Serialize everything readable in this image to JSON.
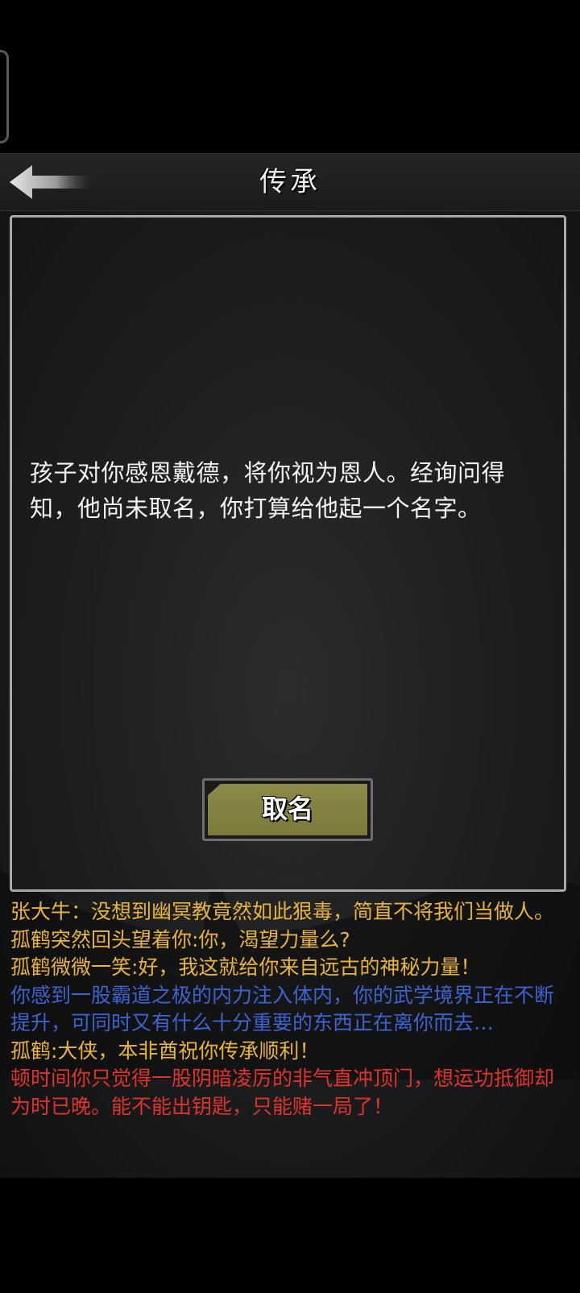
{
  "header": {
    "title": "传承",
    "back_icon": "back-arrow-icon"
  },
  "dialog": {
    "text": "孩子对你感恩戴德，将你视为恩人。经询问得知，他尚未取名，你打算给他起一个名字。",
    "button_label": "取名"
  },
  "log": {
    "lines": [
      {
        "text": "张大牛：没想到幽冥教竟然如此狠毒，简直不将我们当做人。",
        "color": "#e8b43a"
      },
      {
        "text": "孤鹤突然回头望着你:你，渴望力量么?",
        "color": "#e8b43a"
      },
      {
        "text": "孤鹤微微一笑:好，我这就给你来自远古的神秘力量！",
        "color": "#e8b43a"
      },
      {
        "text": "你感到一股霸道之极的内力注入体内，你的武学境界正在不断提升，可同时又有什么十分重要的东西正在离你而去…",
        "color": "#3d63cf"
      },
      {
        "text": "孤鹤:大侠，本非酋祝你传承顺利！",
        "color": "#e8b43a"
      },
      {
        "text": "顿时间你只觉得一股阴暗凌厉的非气直冲顶门，想运功抵御却为时已晚。能不能出钥匙，只能赌一局了！",
        "color": "#e0332c"
      }
    ]
  },
  "colors": {
    "background": "#000000",
    "dialog_border": "#a8a8a8",
    "button_fill": "#848240"
  }
}
